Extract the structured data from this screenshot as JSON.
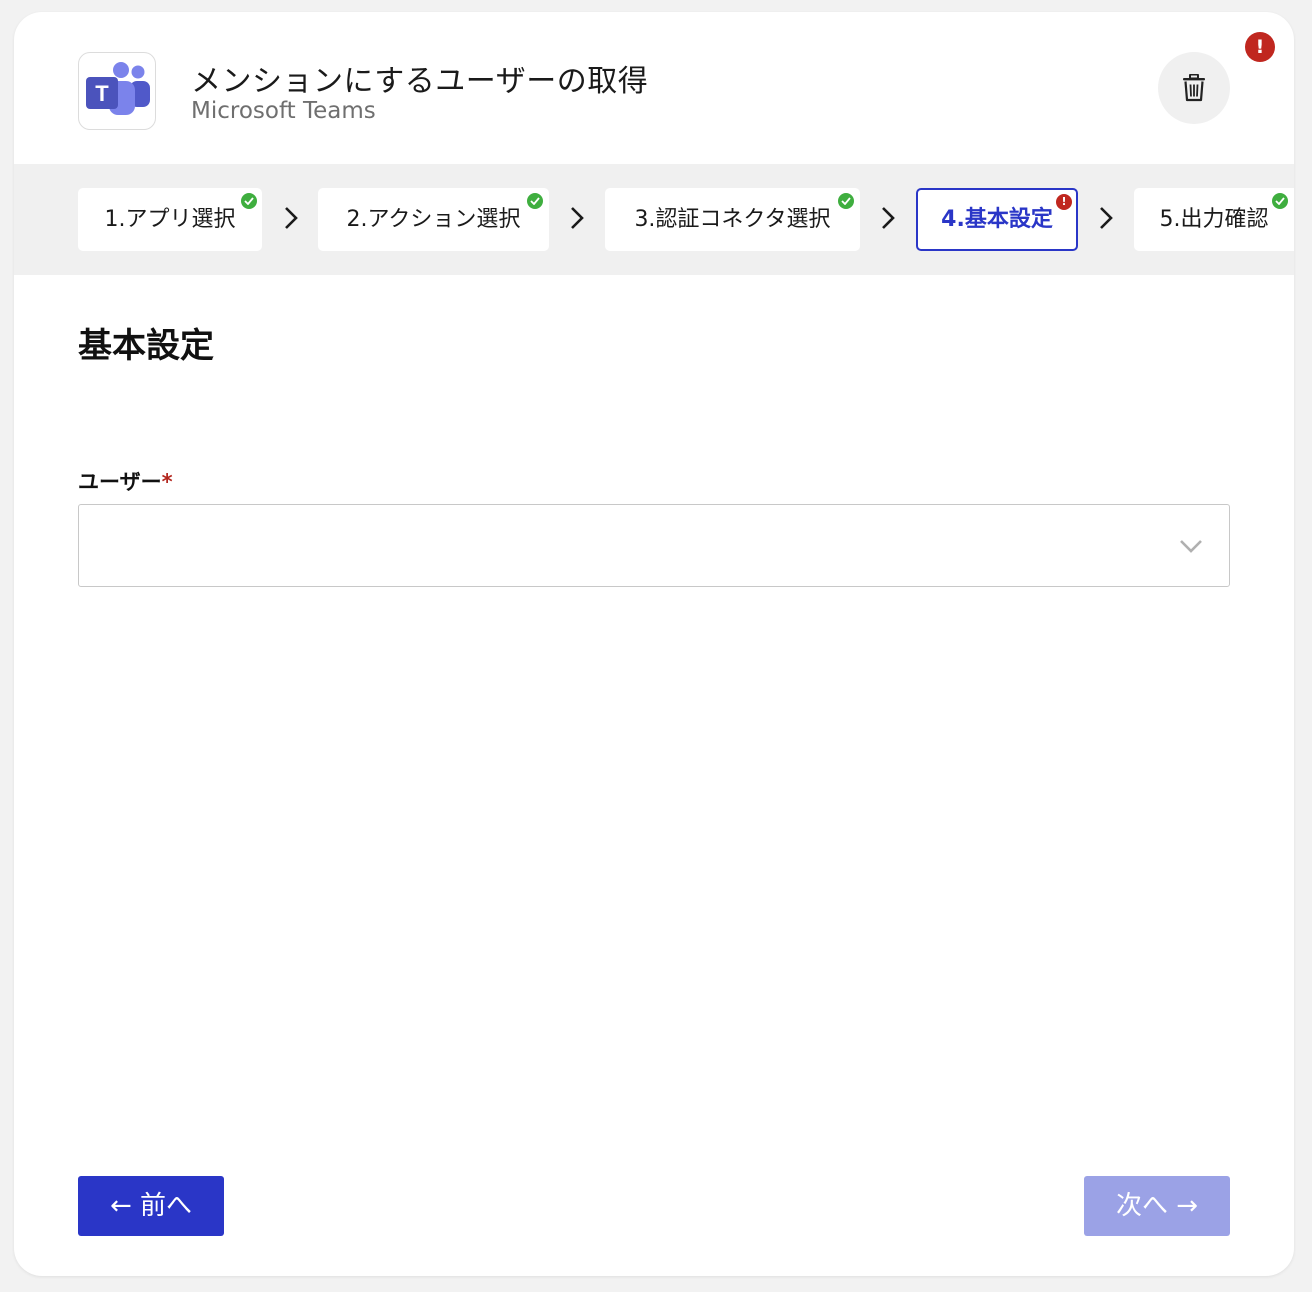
{
  "header": {
    "title": "メンションにするユーザーの取得",
    "subtitle": "Microsoft Teams",
    "logo_letter": "T",
    "error_badge": "!"
  },
  "steps": [
    {
      "label": "1.アプリ選択",
      "status": "done"
    },
    {
      "label": "2.アクション選択",
      "status": "done"
    },
    {
      "label": "3.認証コネクタ選択",
      "status": "done"
    },
    {
      "label": "4.基本設定",
      "status": "error",
      "active": true
    },
    {
      "label": "5.出力確認",
      "status": "done"
    }
  ],
  "step_error_mark": "!",
  "section": {
    "title": "基本設定"
  },
  "form": {
    "user_label": "ユーザー",
    "required_mark": "*",
    "user_value": ""
  },
  "buttons": {
    "prev": "← 前へ",
    "next": "次へ →"
  },
  "colors": {
    "accent": "#2a36c7",
    "accent_disabled": "#9ba2e6",
    "error": "#c0271f",
    "success": "#3fae3f"
  },
  "icons": {
    "app_logo": "teams-logo-icon",
    "delete": "trash-icon",
    "dropdown": "chevron-down-icon",
    "step_separator": "chevron-right-icon",
    "done": "check-icon"
  }
}
